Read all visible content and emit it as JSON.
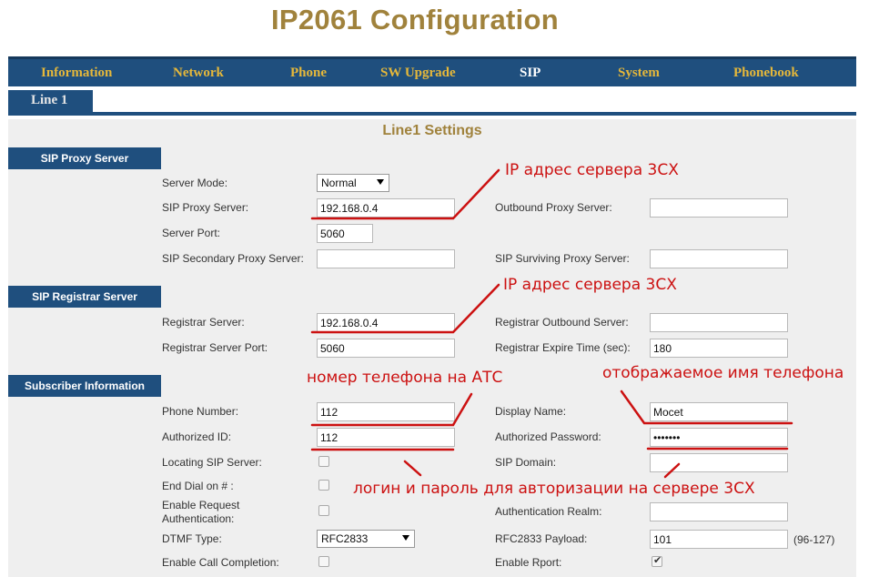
{
  "page": {
    "title": "IP2061 Configuration"
  },
  "nav": {
    "items": [
      {
        "label": "Information"
      },
      {
        "label": "Network"
      },
      {
        "label": "Phone"
      },
      {
        "label": "SW Upgrade"
      },
      {
        "label": "SIP",
        "active": true
      },
      {
        "label": "System"
      },
      {
        "label": "Phonebook"
      }
    ]
  },
  "tabs": {
    "line1": "Line 1"
  },
  "section_title": "Line1 Settings",
  "proxy": {
    "header": "SIP Proxy Server",
    "server_mode_label": "Server Mode:",
    "server_mode_value": "Normal",
    "proxy_label": "SIP Proxy Server:",
    "proxy_value": "192.168.0.4",
    "outbound_label": "Outbound Proxy Server:",
    "outbound_value": "",
    "port_label": "Server Port:",
    "port_value": "5060",
    "secondary_label": "SIP Secondary Proxy Server:",
    "secondary_value": "",
    "surviving_label": "SIP Surviving Proxy Server:",
    "surviving_value": ""
  },
  "registrar": {
    "header": "SIP Registrar Server",
    "server_label": "Registrar Server:",
    "server_value": "192.168.0.4",
    "outbound_label": "Registrar Outbound Server:",
    "outbound_value": "",
    "port_label": "Registrar Server Port:",
    "port_value": "5060",
    "expire_label": "Registrar Expire Time (sec):",
    "expire_value": "180"
  },
  "subscriber": {
    "header": "Subscriber Information",
    "phone_label": "Phone Number:",
    "phone_value": "112",
    "display_label": "Display Name:",
    "display_value": "Mocet",
    "auth_id_label": "Authorized ID:",
    "auth_id_value": "112",
    "auth_pwd_label": "Authorized Password:",
    "auth_pwd_value": "•••••••",
    "locating_label": "Locating SIP Server:",
    "domain_label": "SIP Domain:",
    "domain_value": "",
    "end_dial_label": "End Dial on # :",
    "enable_req_label_1": "Enable Request",
    "enable_req_label_2": "Authentication:",
    "realm_label": "Authentication Realm:",
    "realm_value": "",
    "dtmf_label": "DTMF Type:",
    "dtmf_value": "RFC2833",
    "payload_label": "RFC2833 Payload:",
    "payload_value": "101",
    "payload_range": "(96-127)",
    "call_completion_label": "Enable Call Completion:",
    "rport_label": "Enable Rport:",
    "rport_checked": true
  },
  "annotations": {
    "ip_server_1": "IP адрес сервера 3CX",
    "ip_server_2": "IP адрес сервера 3CX",
    "phone_number": "номер телефона на АТС",
    "display_name": "отображаемое имя телефона",
    "login_password": "логин и пароль для авторизации на сервере 3CX"
  },
  "colors": {
    "nav_bg": "#1f4f7e",
    "nav_text": "#e6b83a",
    "title_gold": "#a0823c",
    "annotation_red": "#cc1111"
  }
}
